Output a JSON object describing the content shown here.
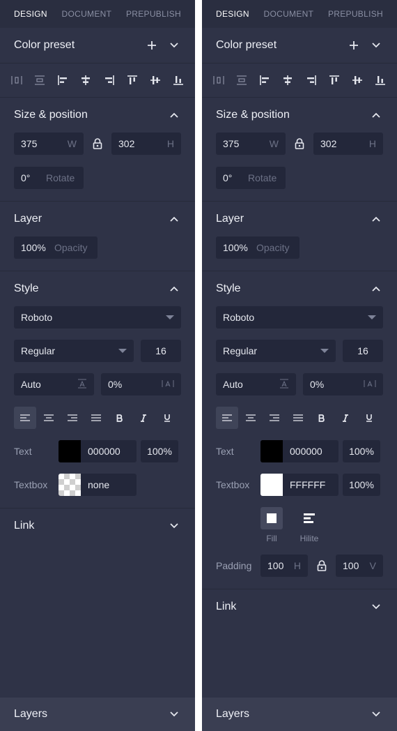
{
  "left": {
    "tabs": [
      "DESIGN",
      "DOCUMENT",
      "PREPUBLISH"
    ],
    "color_preset": {
      "title": "Color preset"
    },
    "size_position": {
      "title": "Size & position",
      "width": "375",
      "width_unit": "W",
      "height": "302",
      "height_unit": "H",
      "rotate": "0°",
      "rotate_label": "Rotate"
    },
    "layer": {
      "title": "Layer",
      "opacity": "100%",
      "opacity_label": "Opacity"
    },
    "style": {
      "title": "Style",
      "font": "Roboto",
      "weight": "Regular",
      "size": "16",
      "line_height": "Auto",
      "letter_spacing": "0%",
      "text_label": "Text",
      "text_color": "000000",
      "text_opacity": "100%",
      "textbox_label": "Textbox",
      "textbox_color": "none"
    },
    "link": {
      "title": "Link"
    },
    "layers": {
      "title": "Layers"
    }
  },
  "right": {
    "tabs": [
      "DESIGN",
      "DOCUMENT",
      "PREPUBLISH"
    ],
    "color_preset": {
      "title": "Color preset"
    },
    "size_position": {
      "title": "Size & position",
      "width": "375",
      "width_unit": "W",
      "height": "302",
      "height_unit": "H",
      "rotate": "0°",
      "rotate_label": "Rotate"
    },
    "layer": {
      "title": "Layer",
      "opacity": "100%",
      "opacity_label": "Opacity"
    },
    "style": {
      "title": "Style",
      "font": "Roboto",
      "weight": "Regular",
      "size": "16",
      "line_height": "Auto",
      "letter_spacing": "0%",
      "text_label": "Text",
      "text_color": "000000",
      "text_opacity": "100%",
      "textbox_label": "Textbox",
      "textbox_color": "FFFFFF",
      "textbox_opacity": "100%",
      "fill_label": "Fill",
      "hilite_label": "Hilite",
      "padding_label": "Padding",
      "padding_h": "100",
      "padding_h_unit": "H",
      "padding_v": "100",
      "padding_v_unit": "V"
    },
    "link": {
      "title": "Link"
    },
    "layers": {
      "title": "Layers"
    }
  },
  "colors": {
    "panel_bg": "#2f3347",
    "tabs_bg": "#2a2e40",
    "field_bg": "#23273a",
    "bottom_bar_bg": "#3a3e52",
    "text_swatch": "#000000",
    "textbox_swatch_right": "#FFFFFF"
  }
}
